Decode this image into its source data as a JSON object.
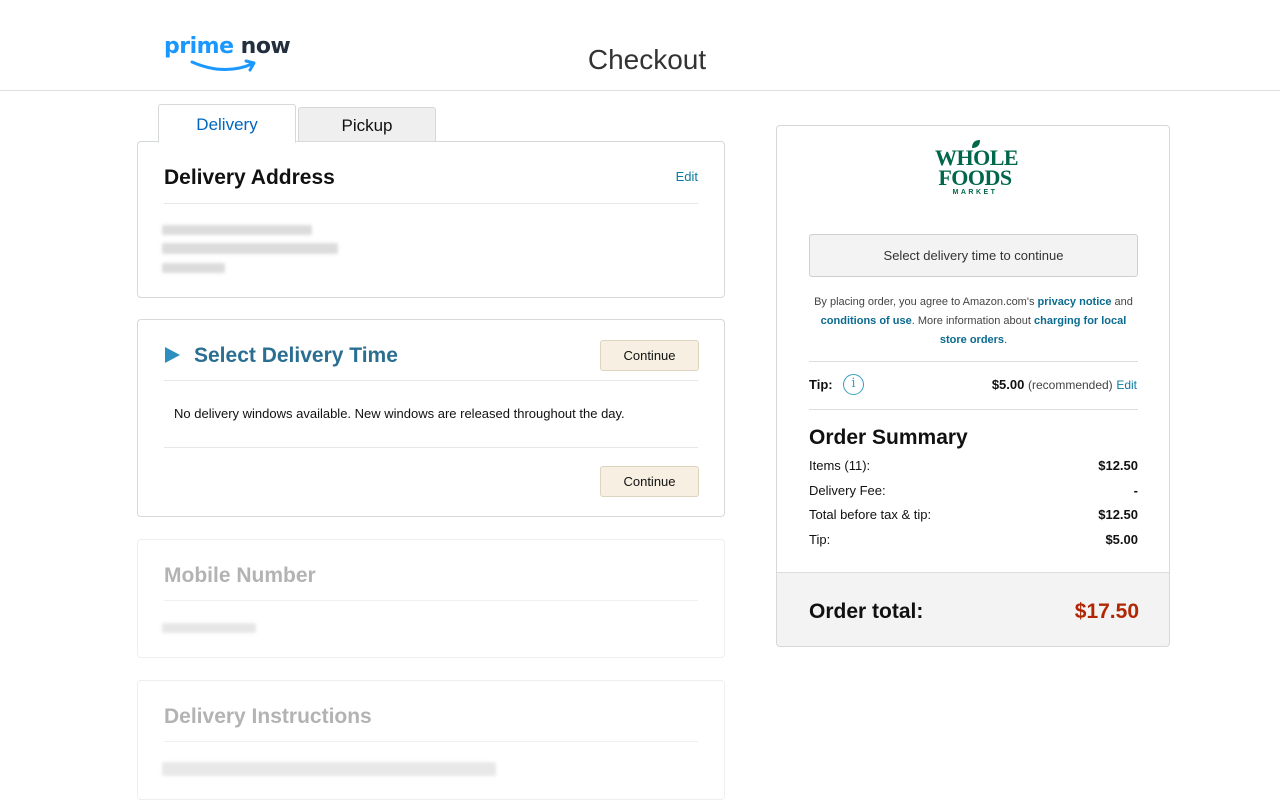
{
  "header": {
    "logo": {
      "word1": "prime",
      "word2": "now"
    },
    "title": "Checkout"
  },
  "tabs": [
    {
      "label": "Delivery",
      "active": true
    },
    {
      "label": "Pickup",
      "active": false
    }
  ],
  "delivery_address": {
    "title": "Delivery Address",
    "edit_label": "Edit"
  },
  "delivery_time": {
    "title": "Select Delivery Time",
    "continue_label": "Continue",
    "message": "No delivery windows available. New windows are released throughout the day."
  },
  "mobile_number": {
    "title": "Mobile Number"
  },
  "delivery_instructions": {
    "title": "Delivery Instructions"
  },
  "summary": {
    "store_logo": {
      "line1": "WHOLE",
      "line2": "FOODS",
      "line3": "MARKET"
    },
    "select_time_button": "Select delivery time to continue",
    "legal": {
      "prefix": "By placing order, you agree to Amazon.com's ",
      "privacy_link": "privacy notice",
      "and": " and ",
      "conditions_link": "conditions of use",
      "middle": ". More information about ",
      "charging_link": "charging for local store orders",
      "suffix": "."
    },
    "tip": {
      "label": "Tip:",
      "amount": "$5.00",
      "recommended": "(recommended)",
      "edit_label": "Edit"
    },
    "order_summary_title": "Order Summary",
    "rows": [
      {
        "label": "Items (11):",
        "value": "$12.50"
      },
      {
        "label": "Delivery Fee:",
        "value": "-"
      },
      {
        "label": "Total before tax & tip:",
        "value": "$12.50"
      },
      {
        "label": "Tip:",
        "value": "$5.00"
      }
    ],
    "order_total_label": "Order total:",
    "order_total_value": "$17.50"
  },
  "colors": {
    "link": "#0a7ba0",
    "accent_blue": "#2a6f92",
    "total_red": "#b12704",
    "wfm_green": "#00674b",
    "continue_button_bg": "#f7f0e2"
  }
}
